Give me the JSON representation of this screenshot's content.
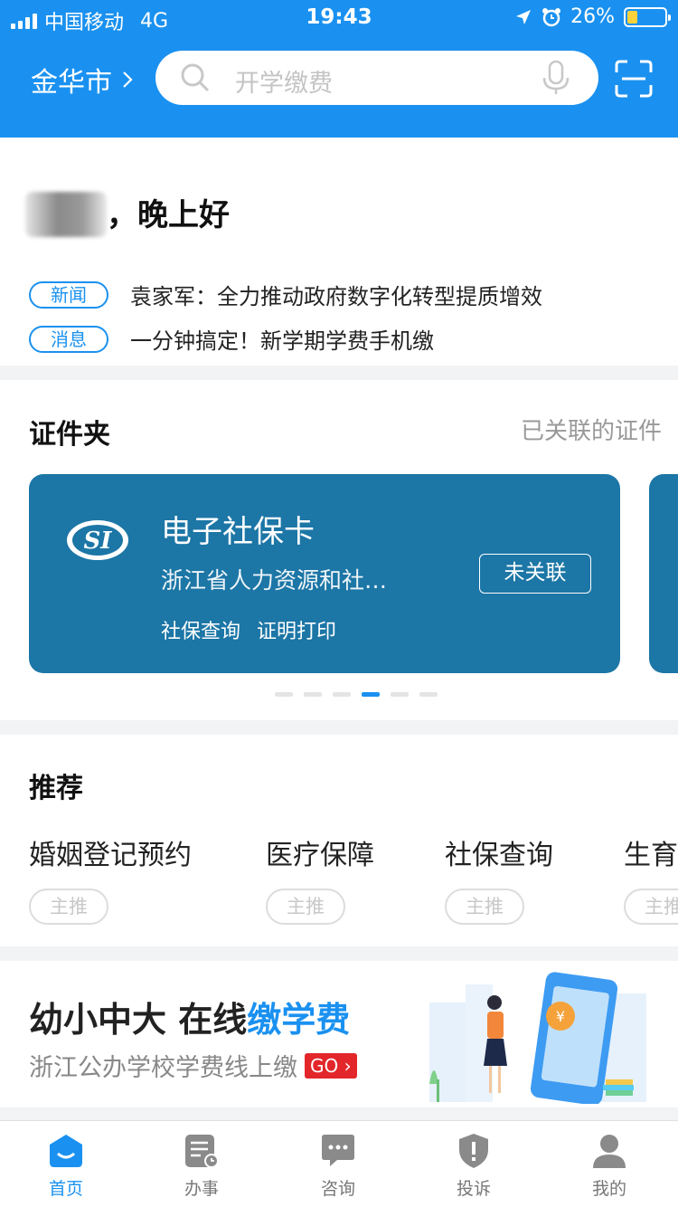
{
  "status": {
    "carrier": "中国移动",
    "network": "4G",
    "time": "19:43",
    "battery": "26%"
  },
  "header": {
    "city": "金华市",
    "search_placeholder": "开学缴费"
  },
  "greeting": {
    "text": "，晚上好",
    "news": [
      {
        "tag": "新闻",
        "text": "袁家军：全力推动政府数字化转型提质增效"
      },
      {
        "tag": "消息",
        "text": "一分钟搞定！新学期学费手机缴"
      }
    ]
  },
  "cert_folder": {
    "title": "证件夹",
    "link": "已关联的证件",
    "card": {
      "logo": "SI",
      "title": "电子社保卡",
      "subtitle": "浙江省人力资源和社…",
      "action1": "社保查询",
      "action2": "证明打印",
      "button": "未关联"
    },
    "page_count": 6,
    "active_page": 4
  },
  "recommend": {
    "title": "推荐",
    "items": [
      {
        "name": "婚姻登记预约",
        "tag": "主推"
      },
      {
        "name": "医疗保障",
        "tag": "主推"
      },
      {
        "name": "社保查询",
        "tag": "主推"
      },
      {
        "name": "生育",
        "tag": "主推"
      }
    ]
  },
  "banner": {
    "title_part1": "幼小中大 在线",
    "title_part2": "缴学费",
    "subtitle": "浙江公办学校学费线上缴",
    "go": "GO"
  },
  "tabbar": {
    "items": [
      {
        "label": "首页",
        "icon": "home-icon"
      },
      {
        "label": "办事",
        "icon": "task-icon"
      },
      {
        "label": "咨询",
        "icon": "chat-icon"
      },
      {
        "label": "投诉",
        "icon": "shield-icon"
      },
      {
        "label": "我的",
        "icon": "user-icon"
      }
    ]
  },
  "colors": {
    "primary": "#1a91f0",
    "card": "#1c76a6",
    "go_red": "#e2262a"
  }
}
